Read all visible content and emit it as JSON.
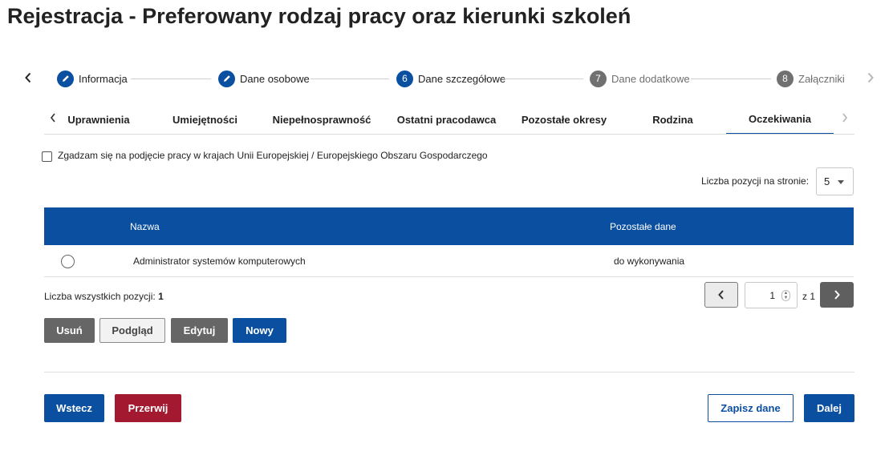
{
  "page_title": "Rejestracja - Preferowany rodzaj pracy oraz kierunki szkoleń",
  "stepper": {
    "prev_icon": "chevron-left-icon",
    "next_icon": "chevron-right-icon",
    "steps": [
      {
        "number": "",
        "icon": "pencil-icon",
        "label": "Informacja",
        "state": "done"
      },
      {
        "number": "",
        "icon": "pencil-icon",
        "label": "Dane osobowe",
        "state": "done"
      },
      {
        "number": "6",
        "label": "Dane szczegółowe",
        "state": "active"
      },
      {
        "number": "7",
        "label": "Dane dodatkowe",
        "state": "inactive"
      },
      {
        "number": "8",
        "label": "Załączniki",
        "state": "inactive"
      }
    ]
  },
  "tabs": {
    "prev_icon": "chevron-left-icon",
    "next_icon": "chevron-right-icon",
    "items": [
      {
        "label": "Uprawnienia"
      },
      {
        "label": "Umiejętności"
      },
      {
        "label": "Niepełnosprawność"
      },
      {
        "label": "Ostatni pracodawca"
      },
      {
        "label": "Pozostałe okresy"
      },
      {
        "label": "Rodzina"
      },
      {
        "label": "Oczekiwania",
        "active": true
      }
    ]
  },
  "eu_checkbox": {
    "label": "Zgadzam się na podjęcie pracy w krajach Unii Europejskiej / Europejskiego Obszaru Gospodarczego",
    "checked": false
  },
  "page_size": {
    "label": "Liczba pozycji na stronie:",
    "value": "5"
  },
  "table": {
    "columns": [
      "Nazwa",
      "Pozostałe dane"
    ],
    "rows": [
      {
        "name": "Administrator systemów komputerowych",
        "other": "do wykonywania"
      }
    ]
  },
  "total": {
    "label": "Liczba wszystkich pozycji:",
    "value": "1"
  },
  "pagination": {
    "current": "1",
    "of_label": "z 1"
  },
  "actions": {
    "delete": "Usuń",
    "preview": "Podgląd",
    "edit": "Edytuj",
    "new": "Nowy"
  },
  "footer": {
    "back": "Wstecz",
    "abort": "Przerwij",
    "save": "Zapisz dane",
    "next": "Dalej"
  },
  "colors": {
    "primary": "#0b4fa1",
    "danger": "#a3192f",
    "neutral": "#666666"
  }
}
